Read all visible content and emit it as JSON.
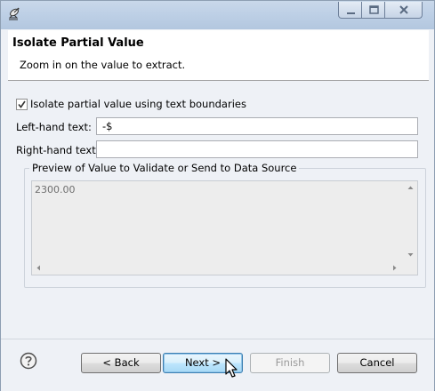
{
  "window": {
    "app_icon": "satellite-dish-icon",
    "controls": [
      "minimize-icon",
      "maximize-icon",
      "close-icon"
    ]
  },
  "header": {
    "title": "Isolate Partial Value",
    "description": "Zoom in on the value to extract."
  },
  "form": {
    "checkbox_label": "Isolate partial value using text boundaries",
    "checkbox_checked": true,
    "left_label": "Left-hand text:",
    "left_value": "-$",
    "right_label": "Right-hand text:",
    "right_value": ""
  },
  "preview": {
    "group_label": "Preview of Value to Validate or Send to Data Source",
    "value": "2300.00"
  },
  "footer": {
    "help_icon": "help-icon",
    "back_label": "< Back",
    "next_label": "Next >",
    "finish_label": "Finish",
    "cancel_label": "Cancel"
  },
  "colors": {
    "accent": "#3c7fb1",
    "window_bg": "#eef1f6",
    "titlebar": "#bed0e6"
  }
}
